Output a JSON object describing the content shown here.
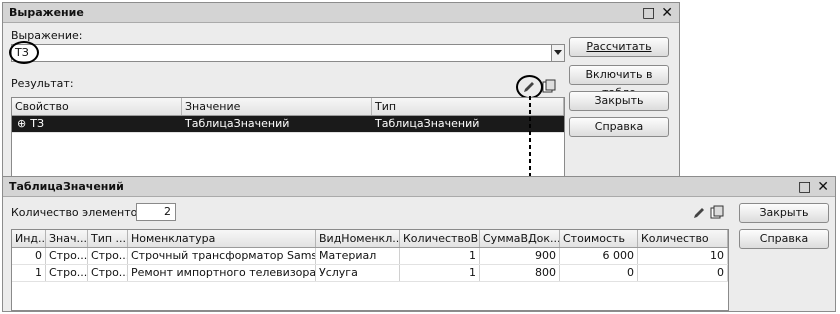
{
  "expr_window": {
    "title": "Выражение",
    "expression_label": "Выражение:",
    "expression_value": "ТЗ",
    "result_label": "Результат:",
    "columns": [
      "Свойство",
      "Значение",
      "Тип"
    ],
    "row": {
      "marker": "⊕",
      "property": "ТЗ",
      "value": "ТаблицаЗначений",
      "type": "ТаблицаЗначений"
    },
    "buttons": {
      "calculate": "Рассчитать",
      "include": "Включить в табло",
      "close": "Закрыть",
      "help": "Справка"
    },
    "maximize_glyph": "□",
    "close_glyph": "✕"
  },
  "table_window": {
    "title": "ТаблицаЗначений",
    "count_label": "Количество элементов:",
    "count_value": "2",
    "columns": [
      "Инд...",
      "Знач...",
      "Тип ...",
      "Номенклатура",
      "ВидНоменкл...",
      "КоличествоВ...",
      "СуммаВДок...",
      "Стоимость",
      "Количество"
    ],
    "rows": [
      [
        "0",
        "Стро...",
        "Стро...",
        "Строчный трансформатор Samsung",
        "Материал",
        "1",
        "900",
        "6 000",
        "10"
      ],
      [
        "1",
        "Стро...",
        "Стро...",
        "Ремонт импортного телевизора",
        "Услуга",
        "1",
        "800",
        "0",
        "0"
      ]
    ],
    "buttons": {
      "close": "Закрыть",
      "help": "Справка"
    },
    "maximize_glyph": "□",
    "close_glyph": "✕"
  },
  "icons": [
    "pencil-icon",
    "copy-icon",
    "dropdown-arrow-icon",
    "down-arrow-icon"
  ]
}
